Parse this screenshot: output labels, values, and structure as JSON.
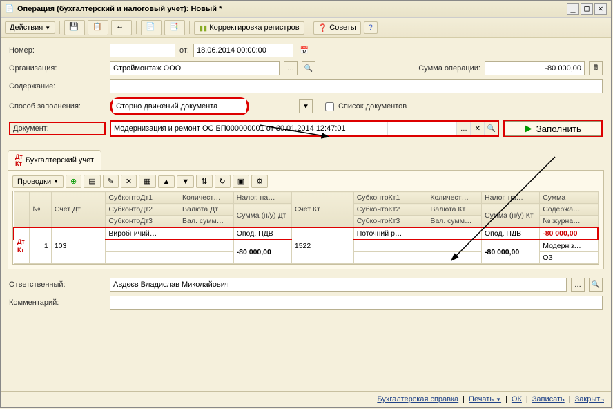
{
  "window": {
    "title": "Операция (бухгалтерский и налоговый учет): Новый *"
  },
  "toolbar": {
    "actions": "Действия",
    "adjust": "Корректировка регистров",
    "tips": "Советы"
  },
  "form": {
    "number_label": "Номер:",
    "number": "",
    "from_label": "от:",
    "from": "18.06.2014 00:00:00",
    "org_label": "Организация:",
    "org": "Строймонтаж ООО",
    "sum_label": "Сумма операции:",
    "sum": "-80 000,00",
    "content_label": "Содержание:",
    "content": "",
    "fill_mode_label": "Способ заполнения:",
    "fill_mode": "Сторно движений документа",
    "list_docs": "Список документов",
    "doc_label": "Документ:",
    "doc": "Модернизация и ремонт ОС БП000000001 от 30.01.2014 12:47:01",
    "fill_btn": "Заполнить"
  },
  "tab": {
    "label": "Бухгалтерский учет"
  },
  "subtoolbar": {
    "entries": "Проводки"
  },
  "headers": {
    "n": "№",
    "acc_dt": "Счет Дт",
    "sub1": "СубконтоДт1",
    "sub2": "СубконтоДт2",
    "sub3": "СубконтоДт3",
    "qty": "Количест…",
    "cur": "Валюта Дт",
    "valsum": "Вал. сумм…",
    "tax": "Налог. на…",
    "sumnu_dt": "Сумма (н/у) Дт",
    "acc_kt": "Счет Кт",
    "subk1": "СубконтоКт1",
    "subk2": "СубконтоКт2",
    "subk3": "СубконтоКт3",
    "curk": "Валюта Кт",
    "valsumk": "Вал. сумм…",
    "sumnu_kt": "Сумма (н/у) Кт",
    "sum": "Сумма",
    "desc": "Содержа…",
    "journ": "№ журна…"
  },
  "row": {
    "n": "1",
    "acc_dt": "103",
    "sub1": "Виробничий…",
    "tax_dt": "Опод. ПДВ",
    "sum_dt": "-80 000,00",
    "acc_kt": "1522",
    "subk1": "Поточний р…",
    "tax_kt": "Опод. ПДВ",
    "sum_kt": "-80 000,00",
    "sum": "-80 000,00",
    "desc": "Модерніз…",
    "journ": "ОЗ"
  },
  "bottom": {
    "resp_label": "Ответственный:",
    "resp": "Авдєєв Владислав Миколайович",
    "comment_label": "Комментарий:",
    "comment": ""
  },
  "footer": {
    "ref": "Бухгалтерская справка",
    "print": "Печать",
    "ok": "ОК",
    "save": "Записать",
    "close": "Закрыть"
  }
}
